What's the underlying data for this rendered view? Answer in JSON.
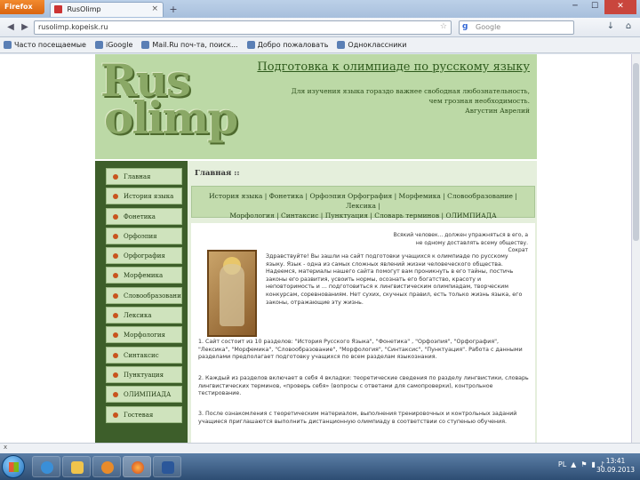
{
  "browser": {
    "app_button": "Firefox",
    "tab_title": "RusOlimp",
    "url": "rusolimp.kopeisk.ru",
    "search_placeholder": "Google",
    "bookmarks": [
      "Часто посещаемые",
      "iGoogle",
      "Mail.Ru поч-та, поиск...",
      "Добро пожаловать",
      "Одноклассники"
    ]
  },
  "site": {
    "logo_line1": "Rus",
    "logo_line2": "olimp",
    "title": "Подготовка к олимпиаде по русскому языку",
    "quote": "Для изучения языка гораздо важнее свободная любознательность, чем грозная необходимость.",
    "quote_author": "Августин Аврелий"
  },
  "sidebar": {
    "items": [
      "Главная",
      "История языка",
      "Фонетика",
      "Орфоэпия",
      "Орфография",
      "Морфемика",
      "Словообразование",
      "Лексика",
      "Морфология",
      "Синтаксис",
      "Пунктуация",
      "ОЛИМПИАДА",
      "Гостевая"
    ]
  },
  "main": {
    "breadcrumb": "Главная ::",
    "topnav_line1": "История языка | Фонетика | Орфоэпия  Орфография | Морфемика | Словообразование | Лексика |",
    "topnav_line2": "Морфология | Синтаксис | Пунктуация | Словарь терминов | ОЛИМПИАДА",
    "epigraph": "Всякий человек... должен упражняться в его, а не одному доставлять всему обществу.",
    "epigraph_author": "Сократ",
    "intro": "Здравствуйте! Вы зашли на сайт подготовки учащихся к олимпиаде по русскому языку. Язык - одна из самых сложных явлений жизни человеческого общества. Надеемся, материалы нашего сайта помогут вам проникнуть в его тайны, постичь законы его развития, усвоить нормы, осознать его богатство, красоту и неповторимость и ... подготовиться к лингвистическим олимпиадам, творческим конкурсам, соревнованиям. Нет сухих, скучных правил, есть только жизнь языка, его законы, отражающие эту жизнь.",
    "para1": "1.   Сайт состоит из 10 разделов: \"История Русского Языка\", \"Фонетика\" , \"Орфоэпия\", \"Орфография\", \"Лексика\", \"Морфемика\", \"Словообразование\", \"Морфология\", \"Синтаксис\", \"Пунктуация\". Работа с данными разделами предполагает подготовку учащихся по всем разделам языкознания.",
    "para2": "2.   Каждый из разделов включает в себя  4 вкладки: теоретические сведения по разделу лингвистики, словарь лингвистических терминов, «проверь себя» (вопросы с ответами для самопроверки), контрольное тестирование.",
    "para3": "3.   После ознакомления с теоретическим материалом, выполнения тренировочных и контрольных заданий учащиеся приглашаются выполнить дистанционную олимпиаду в соответствии со ступенью обучения."
  },
  "statusbar": {
    "close_label": "x"
  },
  "taskbar": {
    "lang": "PL",
    "time": "13:41",
    "date": "30.09.2013"
  }
}
